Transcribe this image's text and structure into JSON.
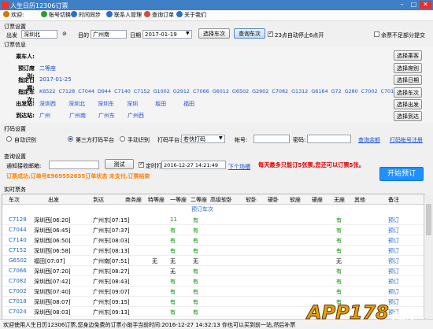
{
  "window": {
    "title": "人生日历12306订票"
  },
  "toolbar": [
    {
      "label": "欢迎:",
      "color": "#d07a00"
    },
    {
      "label": "账号切换",
      "color": "#2d9a2d"
    },
    {
      "label": "时间同步",
      "color": "#2a6fc9"
    },
    {
      "label": "联系人管理",
      "color": "#2a6fc9"
    },
    {
      "label": "查询订单",
      "color": "#d64b3b"
    },
    {
      "label": "关于我们",
      "color": "#2a6fc9"
    }
  ],
  "query": {
    "section": "订票设置",
    "from_label": "出发",
    "from_value": "深圳北",
    "to_label": "目的",
    "to_value": "广州南",
    "date_label": "日期",
    "date_value": "2017-01-19",
    "btn_select": "选择车次",
    "btn_search": "查询车次",
    "auto_stop": "23点自动停止6点开",
    "remain": "余票不足部分提交"
  },
  "info": {
    "section": "订票信息",
    "passenger_label": "乘车人:",
    "seat_label": "预订席别:",
    "seat_value": "二等座",
    "date_label": "指定日期:",
    "date_value": "2017-01-25",
    "trains_label": "指定车次:",
    "trains": [
      "K6522",
      "C7128",
      "C7044",
      "D944",
      "C7140",
      "C7152",
      "G1002",
      "G2912",
      "C7066",
      "G6012",
      "G6502",
      "G2902",
      "C7082",
      "G1312",
      "G6164",
      "G72",
      "G280",
      "C7002",
      "C7018"
    ],
    "depart_label": "出发站:",
    "depart": [
      "深圳西",
      "深圳北",
      "深圳东",
      "深圳",
      "坂田",
      "福田"
    ],
    "arrive_label": "到达站:",
    "arrive": [
      "广州",
      "广州南",
      "广州东",
      "广州西"
    ],
    "btn_passenger": "选择乘客",
    "btn_seat": "选择席别",
    "btn_date": "选择日期",
    "btn_train": "选择车次",
    "btn_depart": "选择出发",
    "btn_arrive": "选择到达"
  },
  "captcha": {
    "section": "打码设置",
    "opt_auto": "自动识别",
    "opt_third": "第三方打码平台",
    "opt_manual": "手动识别",
    "platform_label": "打码平台:",
    "platform_value": "若快打码",
    "account_label": "帐号:",
    "pwd_label": "密码:",
    "link_balance": "查询余额",
    "link_register": "打码帐号注册"
  },
  "settings": {
    "section": "查询设置",
    "email_label": "通知接收邮箱:",
    "btn_test": "测试",
    "timer_label": "定时打开",
    "timer_value": "2016-12-27  14:21:49",
    "next_link": "下个场槽",
    "promo": "每天最多只能订5张票,您还可以订票5张。",
    "success": "订票成功,订单号E969552635订单状态 未支付,订票结束",
    "btn_start": "开始预订"
  },
  "table": {
    "section": "实时票务",
    "headers": [
      "车次",
      "出发",
      "到达",
      "商务座",
      "特等座",
      "一等座",
      "二等座",
      "高级软卧",
      "软卧",
      "硬卧",
      "软座",
      "硬座",
      "无座",
      "其他",
      "备注"
    ],
    "group_label": "预订车次",
    "rows": [
      [
        "C7128",
        "深圳西[06:20]",
        "广州东[07:15]",
        "",
        "",
        "11",
        "有",
        "",
        "",
        "",
        "",
        "",
        "有",
        "",
        "预订"
      ],
      [
        "C7044",
        "深圳西[06:45]",
        "广州东[07:37]",
        "",
        "",
        "有",
        "有",
        "",
        "",
        "",
        "",
        "",
        "有",
        "",
        "预订"
      ],
      [
        "C7140",
        "深圳西[06:50]",
        "广州东[08:03]",
        "",
        "",
        "有",
        "有",
        "",
        "",
        "",
        "",
        "",
        "有",
        "",
        "预订"
      ],
      [
        "C7152",
        "深圳西[06:58]",
        "广州东[08:13]",
        "",
        "",
        "有",
        "有",
        "",
        "",
        "",
        "",
        "",
        "有",
        "",
        "预订"
      ],
      [
        "G6502",
        "福田[07:07]",
        "广州南[07:51]",
        "",
        "无",
        "无",
        "无",
        "",
        "",
        "",
        "",
        "",
        "无",
        "",
        "预订"
      ],
      [
        "C7066",
        "深圳西[07:20]",
        "广州东[08:27]",
        "",
        "",
        "无",
        "有",
        "",
        "",
        "",
        "",
        "",
        "有",
        "",
        "预订"
      ],
      [
        "C7082",
        "深圳西[07:42]",
        "广州东[08:43]",
        "",
        "",
        "有",
        "有",
        "",
        "",
        "",
        "",
        "",
        "有",
        "",
        "预订"
      ],
      [
        "C7002",
        "深圳西[07:40]",
        "广州东[09:07]",
        "",
        "",
        "有",
        "有",
        "",
        "",
        "",
        "",
        "",
        "有",
        "",
        "预订"
      ],
      [
        "C7018",
        "深圳西[08:07]",
        "广州东[09:15]",
        "",
        "",
        "有",
        "有",
        "",
        "",
        "",
        "",
        "",
        "有",
        "",
        "预订"
      ],
      [
        "C7024",
        "深圳西[08:03]",
        "广州东[09:13]",
        "",
        "",
        "有",
        "有",
        "",
        "",
        "",
        "",
        "",
        "有",
        "",
        "预订"
      ]
    ]
  },
  "status": {
    "welcome": "欢迎使用人生日历12306订票,您身边免费的订票小助手",
    "time": "当前时间:2016-12-27 14:32:13",
    "hint": "你也可以买到前一站,然后补票"
  },
  "watermark": "APP178手游网"
}
